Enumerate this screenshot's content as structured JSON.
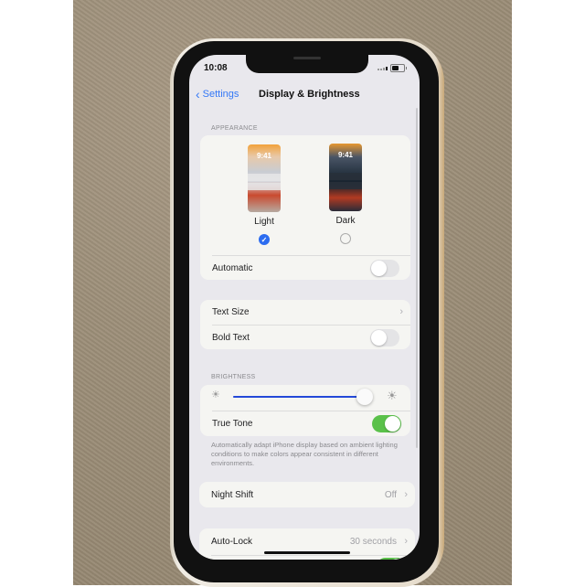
{
  "status_bar": {
    "time": "10:08",
    "signal_icon": "cellular-signal-icon",
    "battery_icon": "battery-icon"
  },
  "nav": {
    "back_label": "Settings",
    "back_icon": "chevron-left-icon",
    "title": "Display & Brightness"
  },
  "appearance": {
    "header": "APPEARANCE",
    "options": [
      {
        "label": "Light",
        "preview_time": "9:41",
        "selected": true
      },
      {
        "label": "Dark",
        "preview_time": "9:41",
        "selected": false
      }
    ],
    "automatic": {
      "label": "Automatic",
      "on": false
    }
  },
  "text_group": {
    "text_size": {
      "label": "Text Size",
      "icon": "chevron-right-icon"
    },
    "bold_text": {
      "label": "Bold Text",
      "on": false
    }
  },
  "brightness": {
    "header": "BRIGHTNESS",
    "slider_value_percent": 96,
    "low_icon": "sun-low-icon",
    "high_icon": "sun-high-icon",
    "true_tone": {
      "label": "True Tone",
      "on": true
    },
    "footnote": "Automatically adapt iPhone display based on ambient lighting conditions to make colors appear consistent in different environments."
  },
  "night_shift": {
    "label": "Night Shift",
    "value": "Off"
  },
  "auto_lock": {
    "label": "Auto-Lock",
    "value": "30 seconds"
  },
  "colors": {
    "accent": "#3478f6",
    "toggle_on": "#5ac14a",
    "slider_fill": "#2449d8"
  },
  "glyphs": {
    "chevron_right": "›",
    "chevron_left": "‹",
    "check": "✓",
    "sun": "☀"
  }
}
